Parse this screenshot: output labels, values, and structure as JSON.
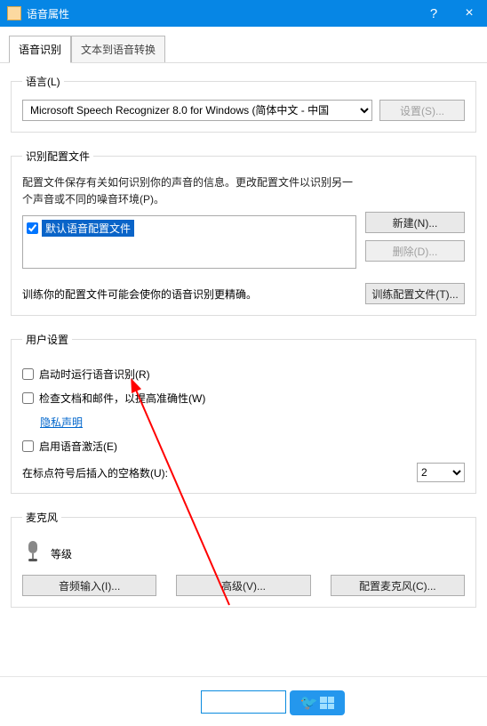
{
  "window": {
    "title": "语音属性",
    "help": "?",
    "close": "×"
  },
  "tabs": {
    "t1": "语音识别",
    "t2": "文本到语音转换"
  },
  "lang": {
    "legend": "语言(L)",
    "selected": "Microsoft Speech Recognizer 8.0 for Windows (简体中文 - 中国",
    "settings_btn": "设置(S)..."
  },
  "profile": {
    "legend": "识别配置文件",
    "desc": "配置文件保存有关如何识别你的声音的信息。更改配置文件以识别另一个声音或不同的噪音环境(P)。",
    "new_btn": "新建(N)...",
    "del_btn": "删除(D)...",
    "item": "默认语音配置文件",
    "train_desc": "训练你的配置文件可能会使你的语音识别更精确。",
    "train_btn": "训练配置文件(T)..."
  },
  "user": {
    "legend": "用户设置",
    "cb_startup": "启动时运行语音识别(R)",
    "cb_review": "检查文档和邮件，以提高准确性(W)",
    "privacy_link": "隐私声明",
    "cb_activate": "启用语音激活(E)",
    "spaces_label": "在标点符号后插入的空格数(U):",
    "spaces_value": "2"
  },
  "mic": {
    "legend": "麦克风",
    "level_label": "等级",
    "btn_audio": "音频输入(I)...",
    "btn_adv": "高级(V)...",
    "btn_cfg": "配置麦克风(C)..."
  }
}
